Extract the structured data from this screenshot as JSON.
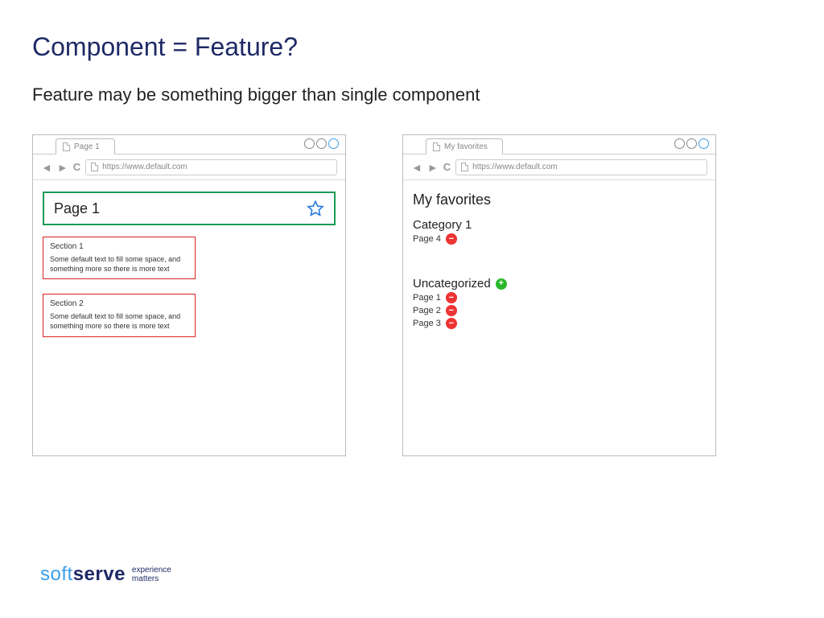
{
  "title": "Component = Feature?",
  "subtitle": "Feature may be something bigger than single component",
  "left": {
    "tab": "Page 1",
    "url": "https://www.default.com",
    "header": "Page 1",
    "sections": [
      {
        "title": "Section 1",
        "body": "Some default text to fill some space, and something more so there is more text"
      },
      {
        "title": "Section 2",
        "body": "Some default text to fill some space, and something more so there is more text"
      }
    ]
  },
  "right": {
    "tab": "My favorites",
    "url": "https://www.default.com",
    "header": "My favorites",
    "categories": [
      {
        "name": "Category 1",
        "add": false,
        "pages": [
          "Page 4"
        ]
      },
      {
        "name": "Uncategorized",
        "add": true,
        "pages": [
          "Page 1",
          "Page 2",
          "Page 3"
        ]
      }
    ]
  },
  "logo": {
    "soft": "soft",
    "serve": "serve",
    "tag1": "experience",
    "tag2": "matters"
  }
}
